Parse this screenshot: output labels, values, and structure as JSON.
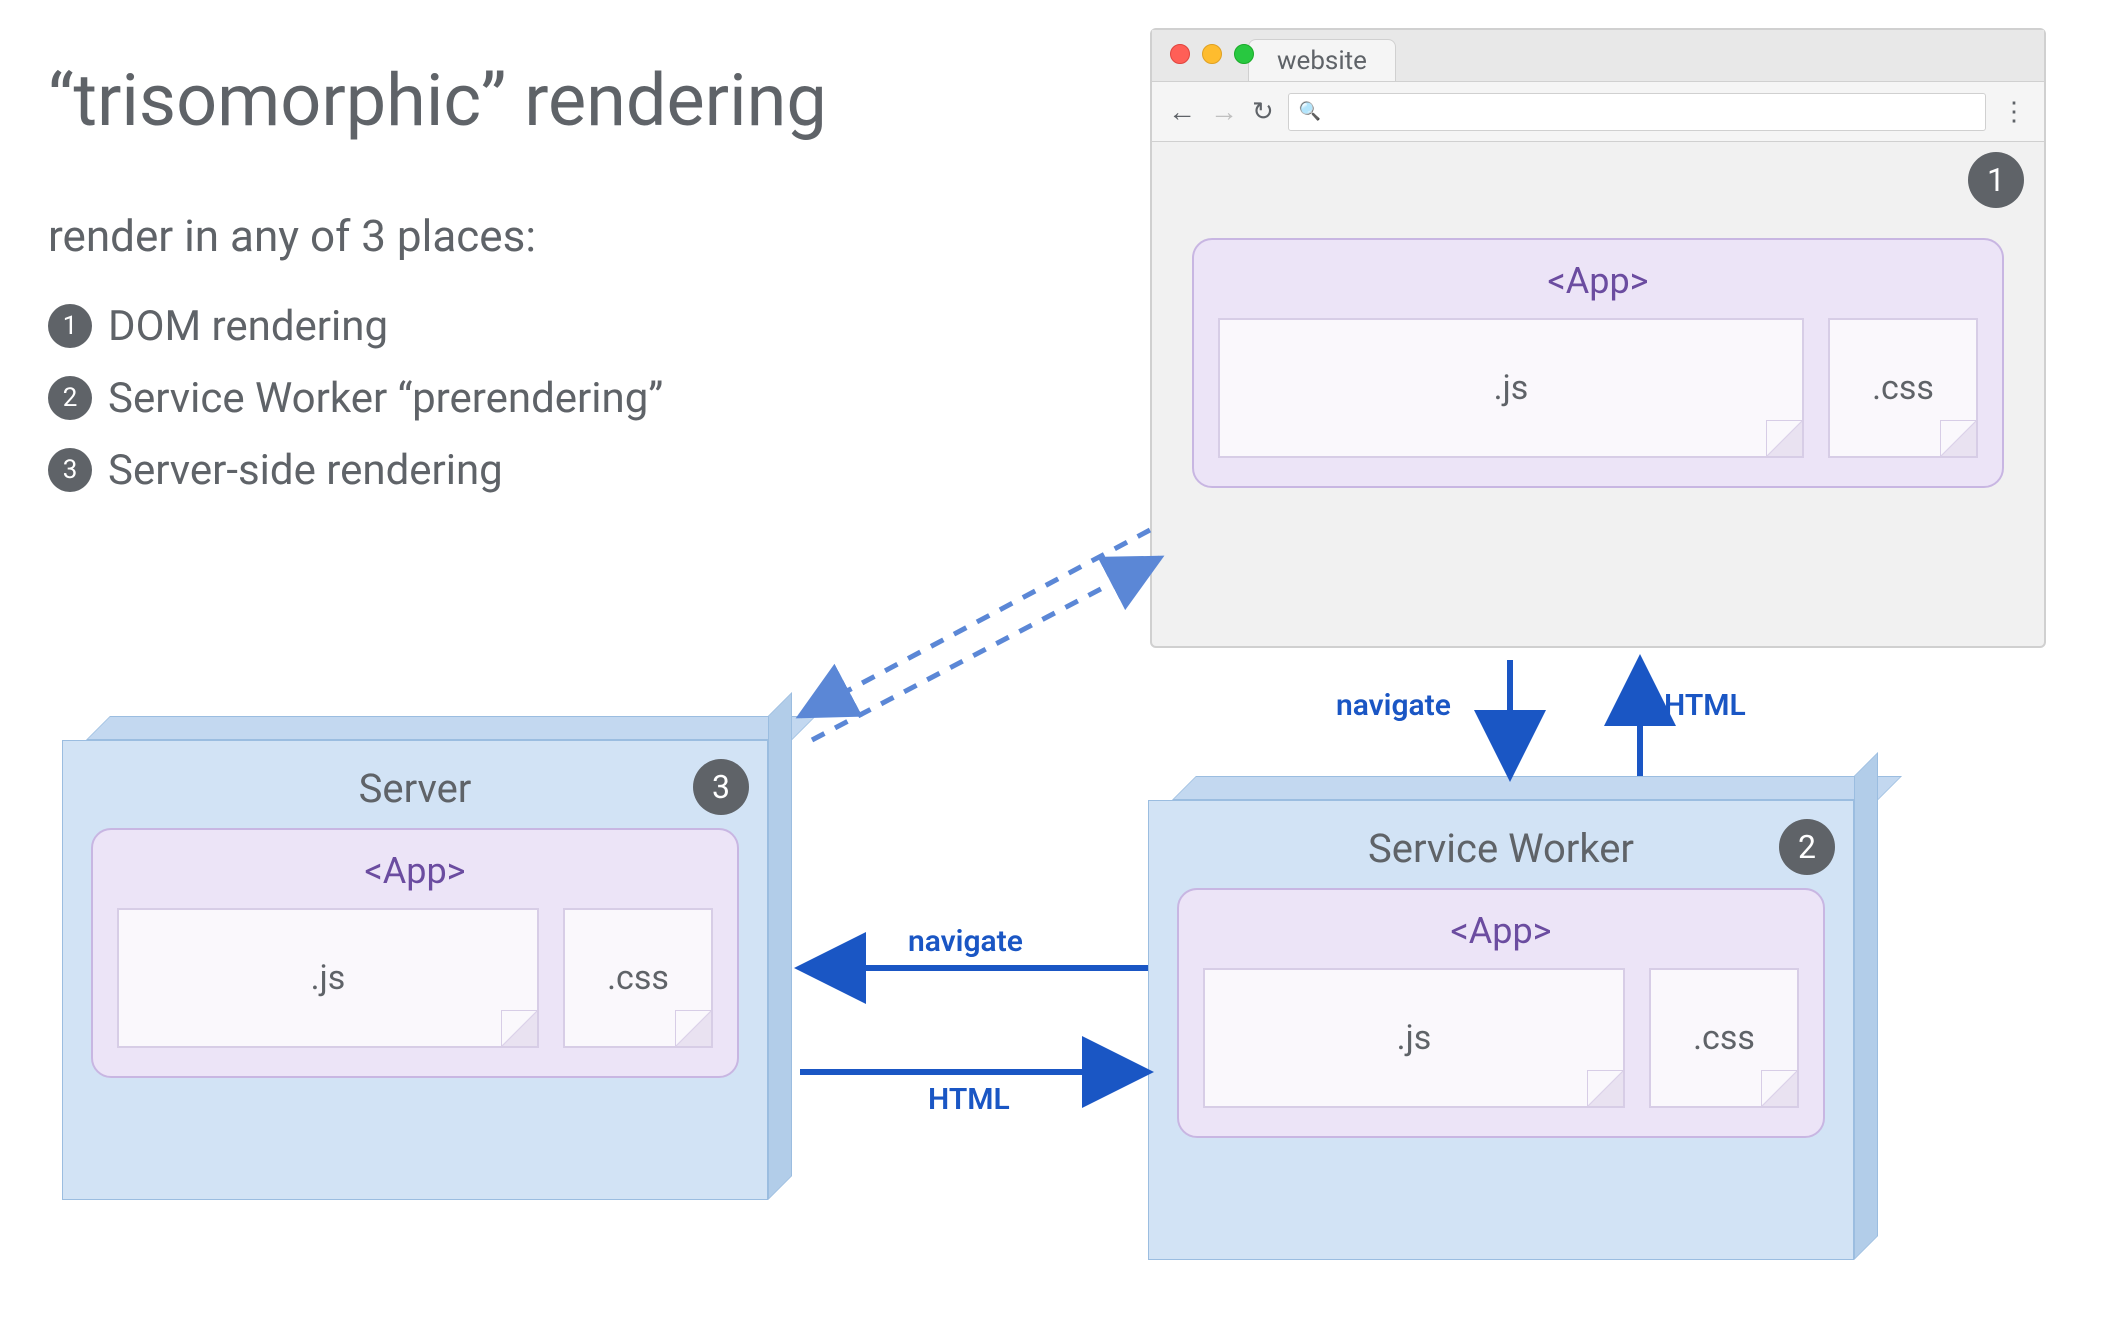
{
  "title": "“trisomorphic” rendering",
  "subtitle": "render in any of 3 places:",
  "list": [
    {
      "n": "1",
      "label": "DOM rendering"
    },
    {
      "n": "2",
      "label": "Service Worker “prerendering”"
    },
    {
      "n": "3",
      "label": "Server-side rendering"
    }
  ],
  "browser": {
    "tab_label": "website",
    "back": "←",
    "forward": "→",
    "reload": "↻",
    "search_icon": "🔍",
    "menu": "⋮",
    "badge": "1",
    "app_label": "<App>",
    "file_js": ".js",
    "file_css": ".css"
  },
  "server_block": {
    "title": "Server",
    "badge": "3",
    "app_label": "<App>",
    "file_js": ".js",
    "file_css": ".css"
  },
  "sw_block": {
    "title": "Service Worker",
    "badge": "2",
    "app_label": "<App>",
    "file_js": ".js",
    "file_css": ".css"
  },
  "arrows": {
    "navigate_v": "navigate",
    "html_v": "HTML",
    "navigate_h": "navigate",
    "html_h": "HTML"
  },
  "colors": {
    "text": "#5f6368",
    "badge_bg": "#5f6368",
    "block_bg": "#d2e3f5",
    "app_bg": "#ece4f7",
    "app_border": "#c8b6e2",
    "app_text": "#6b4ca0",
    "arrow": "#1a56c4"
  }
}
